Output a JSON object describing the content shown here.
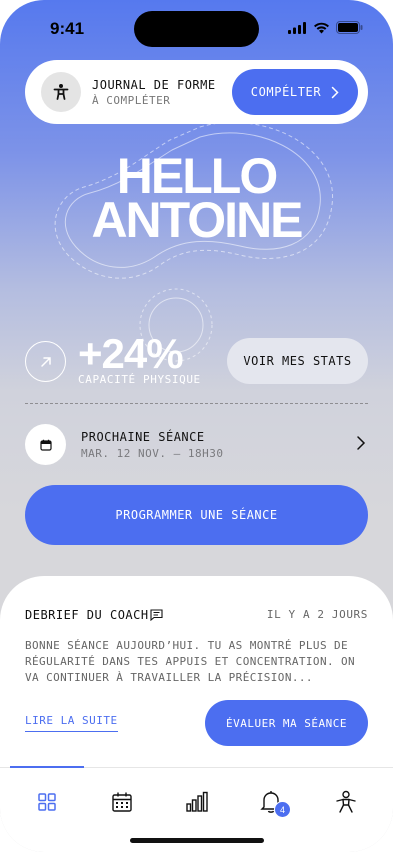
{
  "status_bar": {
    "time": "9:41"
  },
  "journal": {
    "title": "JOURNAL DE FORME",
    "subtitle": "À COMPLÉTER",
    "button_label": "COMPÉLTER"
  },
  "greeting": {
    "line1": "HELLO",
    "line2": "ANTOINE"
  },
  "stats": {
    "value": "+24%",
    "label": "CAPACITÉ PHYSIQUE",
    "button_label": "VOIR MES STATS"
  },
  "next_session": {
    "title": "PROCHAINE SÉANCE",
    "date": "MAR. 12 NOV. — 18H30"
  },
  "program_button": "PROGRAMMER UNE SÉANCE",
  "coach_debrief": {
    "title": "DEBRIEF DU COACH",
    "time": "IL Y A 2 JOURS",
    "text": "BONNE SÉANCE AUJOURD’HUI. TU AS MONTRÉ PLUS DE RÉGULARITÉ DANS TES APPUIS ET CONCENTRATION. ON VA CONTINUER À TRAVAILLER LA PRÉCISION...",
    "read_more": "LIRE LA SUITE",
    "evaluate_button": "ÉVALUER MA SÉANCE"
  },
  "tab_bar": {
    "items": [
      {
        "icon": "dashboard-icon",
        "active": true
      },
      {
        "icon": "calendar-icon",
        "active": false
      },
      {
        "icon": "stats-icon",
        "active": false
      },
      {
        "icon": "bell-icon",
        "active": false
      },
      {
        "icon": "profile-icon",
        "active": false
      }
    ],
    "notification_count": "4"
  },
  "colors": {
    "accent": "#4c6ef0",
    "gradient_top": "#5679ee",
    "gradient_bottom": "#d8d8da"
  }
}
